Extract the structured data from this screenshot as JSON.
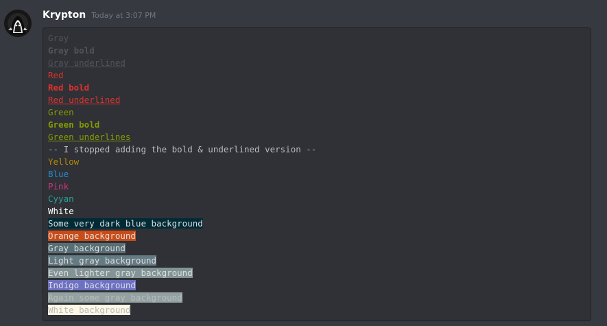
{
  "message": {
    "username": "Krypton",
    "timestamp": "Today at 3:07 PM"
  },
  "code_lines": [
    {
      "text": "Gray",
      "color": "#4f545c"
    },
    {
      "text": "Gray bold",
      "color": "#4f545c",
      "bold": true
    },
    {
      "text": "Gray underlined",
      "color": "#4f545c",
      "underline": true
    },
    {
      "text": "Red",
      "color": "#dc322f"
    },
    {
      "text": "Red bold",
      "color": "#dc322f",
      "bold": true
    },
    {
      "text": "Red underlined",
      "color": "#dc322f",
      "underline": true
    },
    {
      "text": "Green",
      "color": "#859900"
    },
    {
      "text": "Green bold",
      "color": "#859900",
      "bold": true
    },
    {
      "text": "Green underlines",
      "color": "#859900",
      "underline": true
    },
    {
      "text": "-- I stopped adding the bold & underlined version --",
      "color": "#b9bbbe"
    },
    {
      "text": "Yellow",
      "color": "#b58900"
    },
    {
      "text": "Blue",
      "color": "#268bd2"
    },
    {
      "text": "Pink",
      "color": "#d33682"
    },
    {
      "text": "Cyyan",
      "color": "#2aa198"
    },
    {
      "text": "White",
      "color": "#ffffff"
    },
    {
      "text": "Some very dark blue background",
      "color": "#dcddde",
      "bg": "#002b36"
    },
    {
      "text": "Orange background",
      "color": "#dcddde",
      "bg": "#cb4b16"
    },
    {
      "text": "Gray background",
      "color": "#dcddde",
      "bg": "#586e75"
    },
    {
      "text": "Light gray background",
      "color": "#dcddde",
      "bg": "#657b83"
    },
    {
      "text": "Even lighter gray background",
      "color": "#dcddde",
      "bg": "#839496"
    },
    {
      "text": "Indigo background",
      "color": "#dcddde",
      "bg": "#6c71c4"
    },
    {
      "text": "Again some gray background",
      "color": "#b9bbbe",
      "bg": "#93a1a1"
    },
    {
      "text": "White background",
      "color": "#b9bbbe",
      "bg": "#fdf6e3"
    }
  ],
  "icons": {
    "avatar": "avatar-figure-icon"
  }
}
